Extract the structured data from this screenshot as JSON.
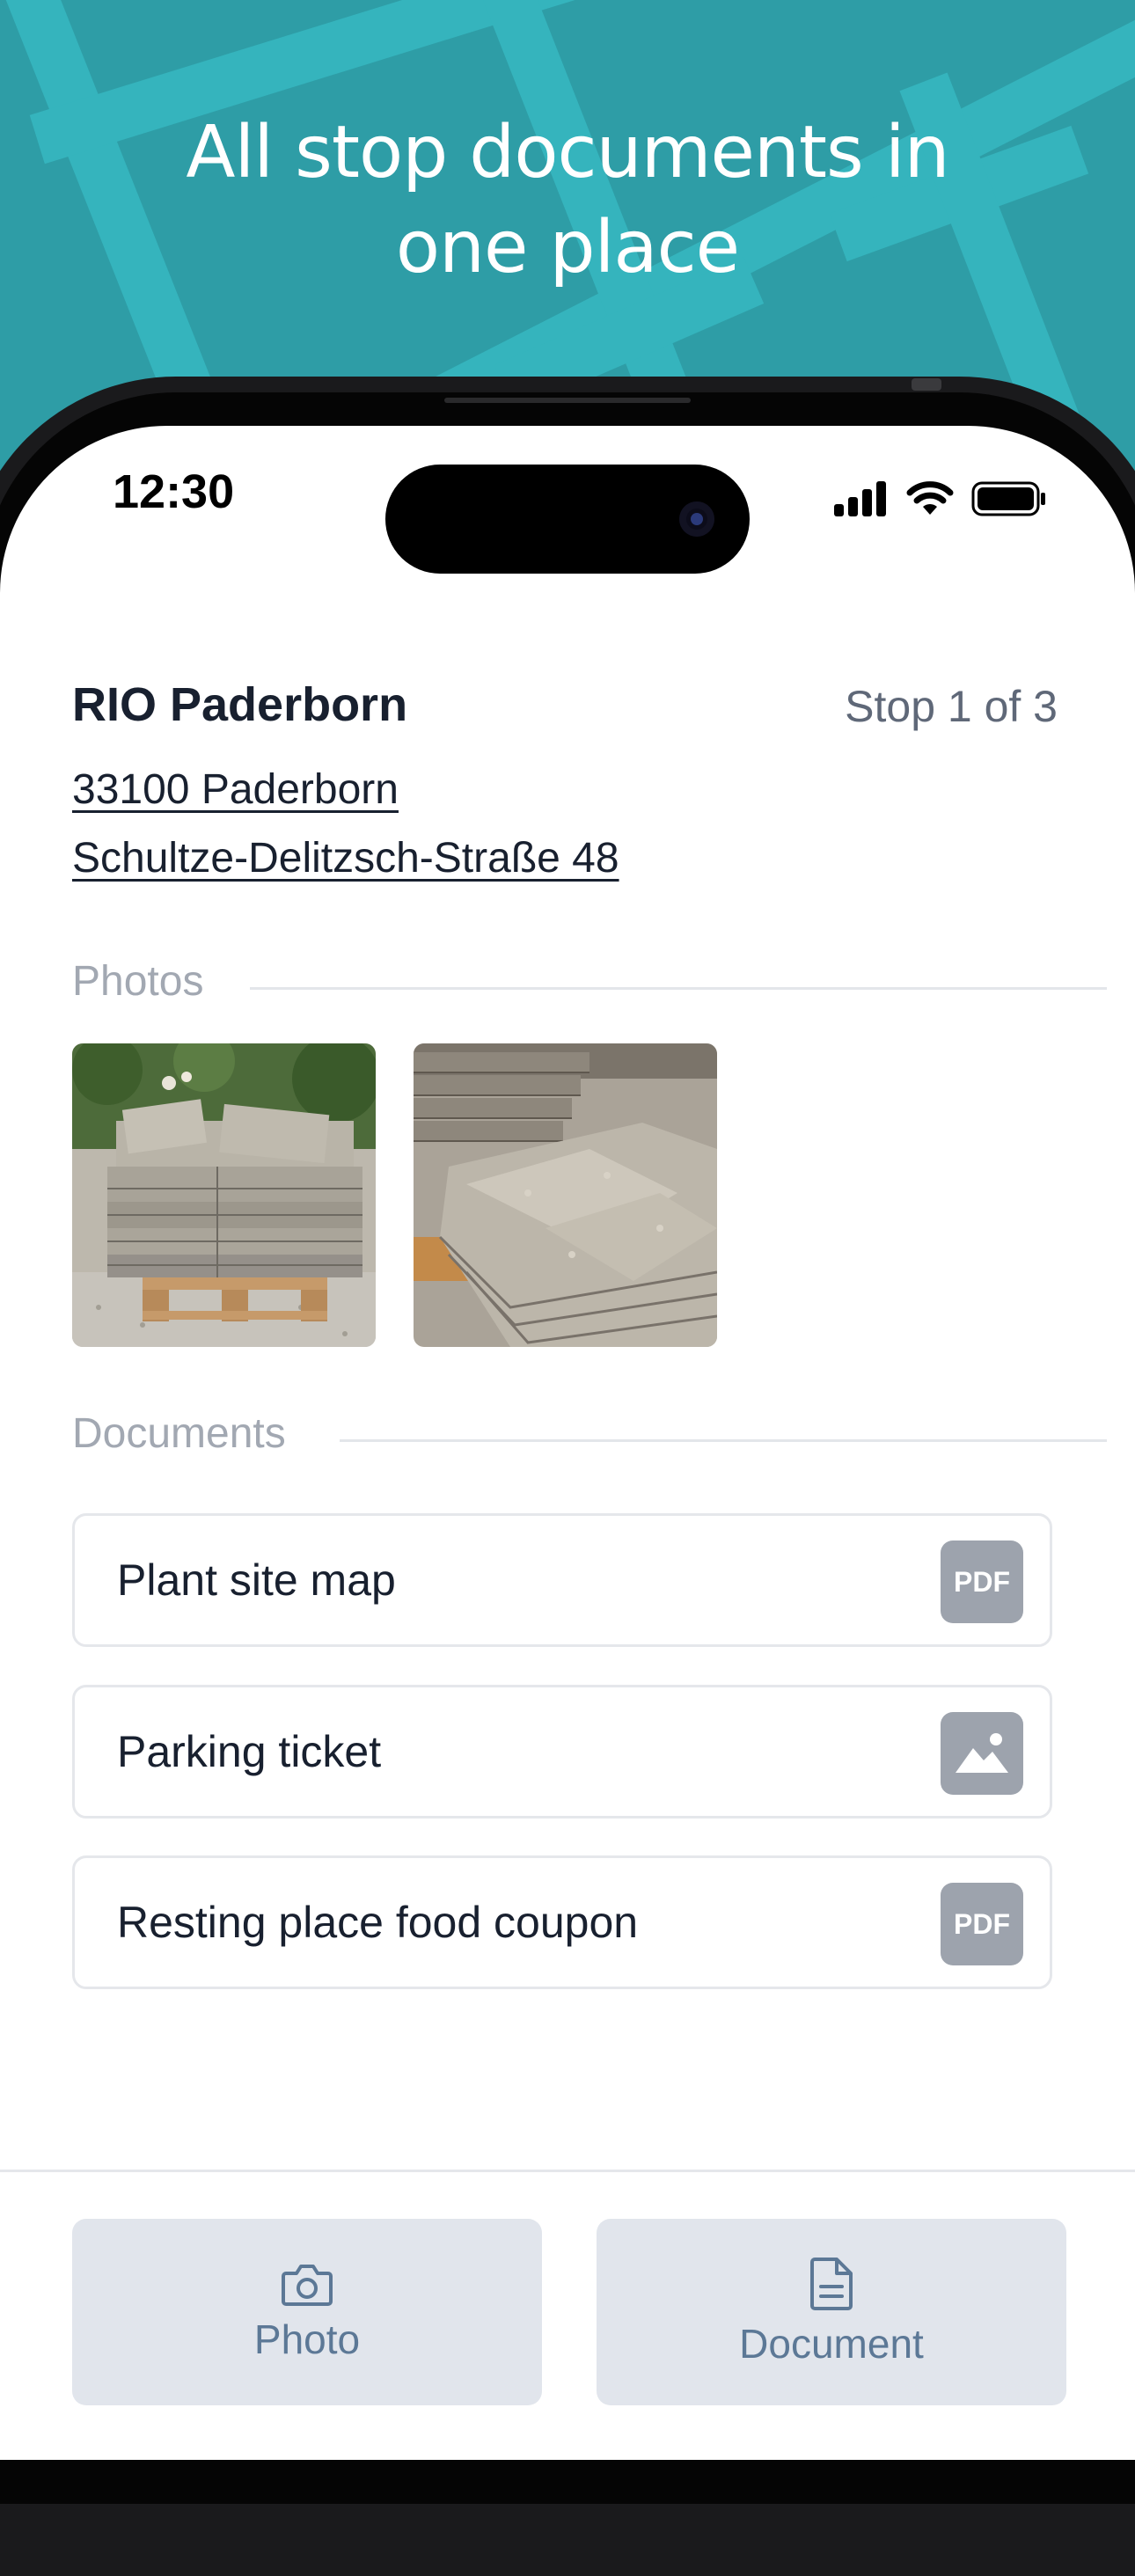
{
  "hero": {
    "title_line1": "All stop documents in",
    "title_line2": "one place"
  },
  "status_bar": {
    "time": "12:30"
  },
  "stop": {
    "name": "RIO Paderborn",
    "counter": "Stop 1 of 3",
    "address_line1": "33100 Paderborn",
    "address_line2": "Schultze-Delitzsch-Straße 48"
  },
  "photos": {
    "label": "Photos",
    "items": [
      "pallet-of-stone-slabs",
      "stacked-stone-slabs"
    ]
  },
  "documents": {
    "label": "Documents",
    "items": [
      {
        "label": "Plant site map",
        "type": "PDF"
      },
      {
        "label": "Parking ticket",
        "type": "image"
      },
      {
        "label": "Resting place food coupon",
        "type": "PDF"
      }
    ]
  },
  "actions": {
    "photo_label": "Photo",
    "document_label": "Document"
  },
  "colors": {
    "hero_bg": "#2e9da6",
    "text_primary": "#18202f",
    "text_secondary": "#5f6878",
    "badge_bg": "#9da3ad",
    "action_bg": "#e1e5ec",
    "action_fg": "#5c7896"
  }
}
